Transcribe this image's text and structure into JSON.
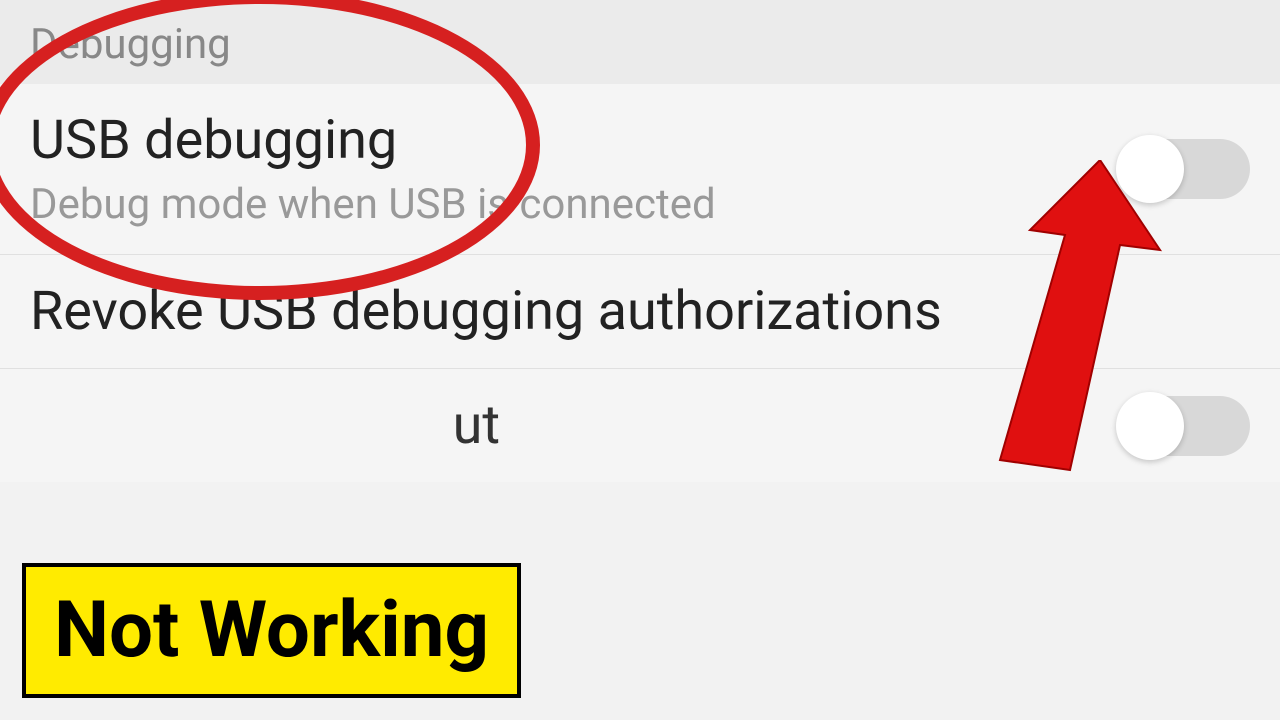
{
  "section": {
    "header": "Debugging",
    "items": [
      {
        "title": "USB debugging",
        "subtitle": "Debug mode when USB is connected",
        "has_toggle": true,
        "toggle_on": false
      },
      {
        "title": "Revoke USB debugging authorizations",
        "subtitle": "",
        "has_toggle": false
      }
    ],
    "partial_item": {
      "visible_text": "ut",
      "has_toggle": true,
      "toggle_on": false
    }
  },
  "annotation": {
    "label": "Not Working"
  }
}
